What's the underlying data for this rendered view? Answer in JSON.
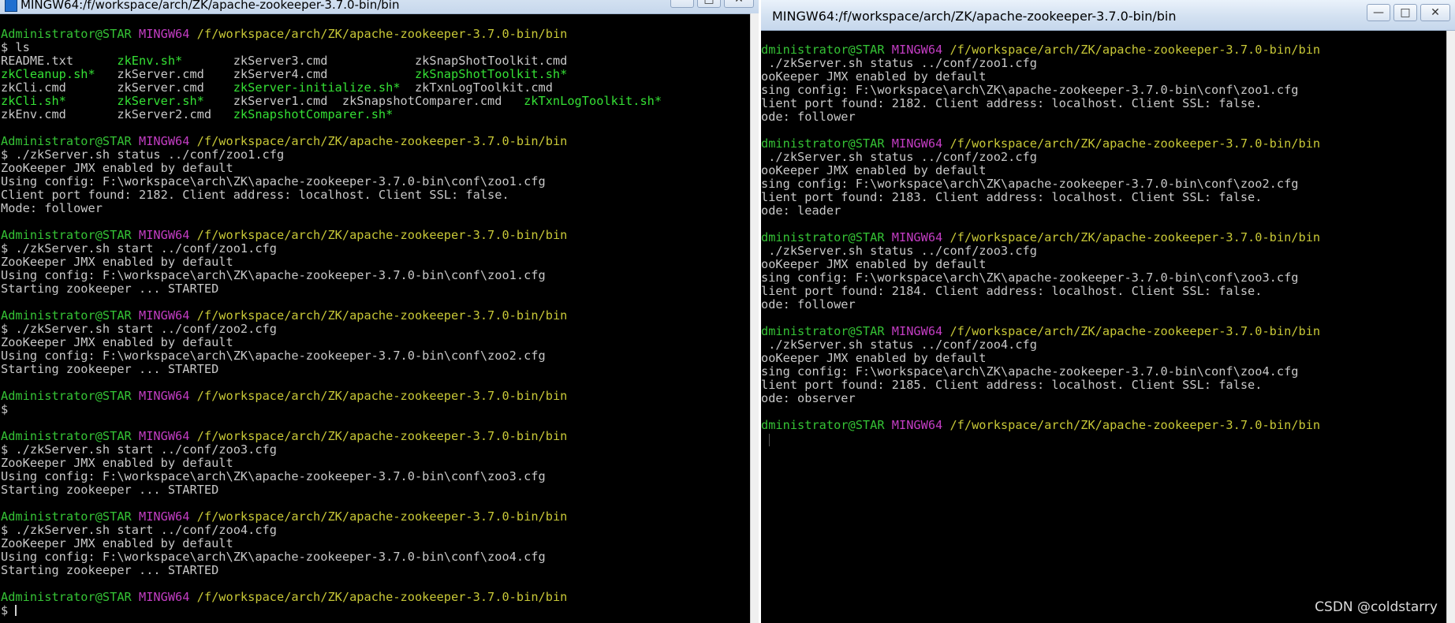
{
  "left_window": {
    "title": "MINGW64:/f/workspace/arch/ZK/apache-zookeeper-3.7.0-bin/bin",
    "controls": {
      "minimize": "—",
      "maximize": "□",
      "close": "✕"
    },
    "lines": [
      [
        {
          "t": "Administrator@STAR",
          "c": "user"
        },
        {
          "t": " MINGW64",
          "c": "mingw"
        },
        {
          "t": " /f/workspace/arch/ZK/apache-zookeeper-3.7.0-bin/bin",
          "c": "path"
        }
      ],
      [
        {
          "t": "$ ls",
          "c": "plain"
        }
      ],
      [
        {
          "t": "README.txt      ",
          "c": "plain"
        },
        {
          "t": "zkEnv.sh*",
          "c": "exe"
        },
        {
          "t": "       zkServer3.cmd            ",
          "c": "plain"
        },
        {
          "t": "zkSnapShotToolkit.cmd",
          "c": "plain"
        }
      ],
      [
        {
          "t": "zkCleanup.sh*",
          "c": "exe"
        },
        {
          "t": "   zkServer.cmd    zkServer4.cmd            ",
          "c": "plain"
        },
        {
          "t": "zkSnapShotToolkit.sh*",
          "c": "exe"
        }
      ],
      [
        {
          "t": "zkCli.cmd       zkServer.cmd    ",
          "c": "plain"
        },
        {
          "t": "zkServer-initialize.sh*",
          "c": "exe"
        },
        {
          "t": "  zkTxnLogToolkit.cmd",
          "c": "plain"
        }
      ],
      [
        {
          "t": "zkCli.sh*",
          "c": "exe"
        },
        {
          "t": "       ",
          "c": "plain"
        },
        {
          "t": "zkServer.sh*",
          "c": "exe"
        },
        {
          "t": "    zkServer1.cmd  zkSnapshotComparer.cmd   ",
          "c": "plain"
        },
        {
          "t": "zkTxnLogToolkit.sh*",
          "c": "exe"
        }
      ],
      [
        {
          "t": "zkEnv.cmd       zkServer2.cmd   ",
          "c": "plain"
        },
        {
          "t": "zkSnapshotComparer.sh*",
          "c": "exe"
        }
      ],
      [],
      [
        {
          "t": "Administrator@STAR",
          "c": "user"
        },
        {
          "t": " MINGW64",
          "c": "mingw"
        },
        {
          "t": " /f/workspace/arch/ZK/apache-zookeeper-3.7.0-bin/bin",
          "c": "path"
        }
      ],
      [
        {
          "t": "$ ./zkServer.sh status ../conf/zoo1.cfg",
          "c": "plain"
        }
      ],
      [
        {
          "t": "ZooKeeper JMX enabled by default",
          "c": "plain"
        }
      ],
      [
        {
          "t": "Using config: F:\\workspace\\arch\\ZK\\apache-zookeeper-3.7.0-bin\\conf\\zoo1.cfg",
          "c": "plain"
        }
      ],
      [
        {
          "t": "Client port found: 2182. Client address: localhost. Client SSL: false.",
          "c": "plain"
        }
      ],
      [
        {
          "t": "Mode: follower",
          "c": "plain"
        }
      ],
      [],
      [
        {
          "t": "Administrator@STAR",
          "c": "user"
        },
        {
          "t": " MINGW64",
          "c": "mingw"
        },
        {
          "t": " /f/workspace/arch/ZK/apache-zookeeper-3.7.0-bin/bin",
          "c": "path"
        }
      ],
      [
        {
          "t": "$ ./zkServer.sh start ../conf/zoo1.cfg",
          "c": "plain"
        }
      ],
      [
        {
          "t": "ZooKeeper JMX enabled by default",
          "c": "plain"
        }
      ],
      [
        {
          "t": "Using config: F:\\workspace\\arch\\ZK\\apache-zookeeper-3.7.0-bin\\conf\\zoo1.cfg",
          "c": "plain"
        }
      ],
      [
        {
          "t": "Starting zookeeper ... STARTED",
          "c": "plain"
        }
      ],
      [],
      [
        {
          "t": "Administrator@STAR",
          "c": "user"
        },
        {
          "t": " MINGW64",
          "c": "mingw"
        },
        {
          "t": " /f/workspace/arch/ZK/apache-zookeeper-3.7.0-bin/bin",
          "c": "path"
        }
      ],
      [
        {
          "t": "$ ./zkServer.sh start ../conf/zoo2.cfg",
          "c": "plain"
        }
      ],
      [
        {
          "t": "ZooKeeper JMX enabled by default",
          "c": "plain"
        }
      ],
      [
        {
          "t": "Using config: F:\\workspace\\arch\\ZK\\apache-zookeeper-3.7.0-bin\\conf\\zoo2.cfg",
          "c": "plain"
        }
      ],
      [
        {
          "t": "Starting zookeeper ... STARTED",
          "c": "plain"
        }
      ],
      [],
      [
        {
          "t": "Administrator@STAR",
          "c": "user"
        },
        {
          "t": " MINGW64",
          "c": "mingw"
        },
        {
          "t": " /f/workspace/arch/ZK/apache-zookeeper-3.7.0-bin/bin",
          "c": "path"
        }
      ],
      [
        {
          "t": "$",
          "c": "plain"
        }
      ],
      [],
      [
        {
          "t": "Administrator@STAR",
          "c": "user"
        },
        {
          "t": " MINGW64",
          "c": "mingw"
        },
        {
          "t": " /f/workspace/arch/ZK/apache-zookeeper-3.7.0-bin/bin",
          "c": "path"
        }
      ],
      [
        {
          "t": "$ ./zkServer.sh start ../conf/zoo3.cfg",
          "c": "plain"
        }
      ],
      [
        {
          "t": "ZooKeeper JMX enabled by default",
          "c": "plain"
        }
      ],
      [
        {
          "t": "Using config: F:\\workspace\\arch\\ZK\\apache-zookeeper-3.7.0-bin\\conf\\zoo3.cfg",
          "c": "plain"
        }
      ],
      [
        {
          "t": "Starting zookeeper ... STARTED",
          "c": "plain"
        }
      ],
      [],
      [
        {
          "t": "Administrator@STAR",
          "c": "user"
        },
        {
          "t": " MINGW64",
          "c": "mingw"
        },
        {
          "t": " /f/workspace/arch/ZK/apache-zookeeper-3.7.0-bin/bin",
          "c": "path"
        }
      ],
      [
        {
          "t": "$ ./zkServer.sh start ../conf/zoo4.cfg",
          "c": "plain"
        }
      ],
      [
        {
          "t": "ZooKeeper JMX enabled by default",
          "c": "plain"
        }
      ],
      [
        {
          "t": "Using config: F:\\workspace\\arch\\ZK\\apache-zookeeper-3.7.0-bin\\conf\\zoo4.cfg",
          "c": "plain"
        }
      ],
      [
        {
          "t": "Starting zookeeper ... STARTED",
          "c": "plain"
        }
      ],
      [],
      [
        {
          "t": "Administrator@STAR",
          "c": "user"
        },
        {
          "t": " MINGW64",
          "c": "mingw"
        },
        {
          "t": " /f/workspace/arch/ZK/apache-zookeeper-3.7.0-bin/bin",
          "c": "path"
        }
      ],
      [
        {
          "t": "$ ",
          "c": "plain"
        },
        {
          "cursor": true
        }
      ]
    ]
  },
  "right_window": {
    "title": "MINGW64:/f/workspace/arch/ZK/apache-zookeeper-3.7.0-bin/bin",
    "controls": {
      "minimize": "—",
      "maximize": "□",
      "close": "✕"
    },
    "lines": [
      [
        {
          "t": "dministrator@STAR",
          "c": "user"
        },
        {
          "t": " MINGW64",
          "c": "mingw"
        },
        {
          "t": " /f/workspace/arch/ZK/apache-zookeeper-3.7.0-bin/bin",
          "c": "path"
        }
      ],
      [
        {
          "t": " ./zkServer.sh status ../conf/zoo1.cfg",
          "c": "plain"
        }
      ],
      [
        {
          "t": "ooKeeper JMX enabled by default",
          "c": "plain"
        }
      ],
      [
        {
          "t": "sing config: F:\\workspace\\arch\\ZK\\apache-zookeeper-3.7.0-bin\\conf\\zoo1.cfg",
          "c": "plain"
        }
      ],
      [
        {
          "t": "lient port found: 2182. Client address: localhost. Client SSL: false.",
          "c": "plain"
        }
      ],
      [
        {
          "t": "ode: follower",
          "c": "plain"
        }
      ],
      [],
      [
        {
          "t": "dministrator@STAR",
          "c": "user"
        },
        {
          "t": " MINGW64",
          "c": "mingw"
        },
        {
          "t": " /f/workspace/arch/ZK/apache-zookeeper-3.7.0-bin/bin",
          "c": "path"
        }
      ],
      [
        {
          "t": " ./zkServer.sh status ../conf/zoo2.cfg",
          "c": "plain"
        }
      ],
      [
        {
          "t": "ooKeeper JMX enabled by default",
          "c": "plain"
        }
      ],
      [
        {
          "t": "sing config: F:\\workspace\\arch\\ZK\\apache-zookeeper-3.7.0-bin\\conf\\zoo2.cfg",
          "c": "plain"
        }
      ],
      [
        {
          "t": "lient port found: 2183. Client address: localhost. Client SSL: false.",
          "c": "plain"
        }
      ],
      [
        {
          "t": "ode: leader",
          "c": "plain"
        }
      ],
      [],
      [
        {
          "t": "dministrator@STAR",
          "c": "user"
        },
        {
          "t": " MINGW64",
          "c": "mingw"
        },
        {
          "t": " /f/workspace/arch/ZK/apache-zookeeper-3.7.0-bin/bin",
          "c": "path"
        }
      ],
      [
        {
          "t": " ./zkServer.sh status ../conf/zoo3.cfg",
          "c": "plain"
        }
      ],
      [
        {
          "t": "ooKeeper JMX enabled by default",
          "c": "plain"
        }
      ],
      [
        {
          "t": "sing config: F:\\workspace\\arch\\ZK\\apache-zookeeper-3.7.0-bin\\conf\\zoo3.cfg",
          "c": "plain"
        }
      ],
      [
        {
          "t": "lient port found: 2184. Client address: localhost. Client SSL: false.",
          "c": "plain"
        }
      ],
      [
        {
          "t": "ode: follower",
          "c": "plain"
        }
      ],
      [],
      [
        {
          "t": "dministrator@STAR",
          "c": "user"
        },
        {
          "t": " MINGW64",
          "c": "mingw"
        },
        {
          "t": " /f/workspace/arch/ZK/apache-zookeeper-3.7.0-bin/bin",
          "c": "path"
        }
      ],
      [
        {
          "t": " ./zkServer.sh status ../conf/zoo4.cfg",
          "c": "plain"
        }
      ],
      [
        {
          "t": "ooKeeper JMX enabled by default",
          "c": "plain"
        }
      ],
      [
        {
          "t": "sing config: F:\\workspace\\arch\\ZK\\apache-zookeeper-3.7.0-bin\\conf\\zoo4.cfg",
          "c": "plain"
        }
      ],
      [
        {
          "t": "lient port found: 2185. Client address: localhost. Client SSL: false.",
          "c": "plain"
        }
      ],
      [
        {
          "t": "ode: observer",
          "c": "plain"
        }
      ],
      [],
      [
        {
          "t": "dministrator@STAR",
          "c": "user"
        },
        {
          "t": " MINGW64",
          "c": "mingw"
        },
        {
          "t": " /f/workspace/arch/ZK/apache-zookeeper-3.7.0-bin/bin",
          "c": "path"
        }
      ]
    ]
  },
  "watermark": "CSDN @coldstarry",
  "colors": {
    "background": "#000000",
    "prompt_user": "#35c335",
    "prompt_mingw": "#c33dc3",
    "prompt_path": "#c8c837",
    "executable": "#35e035",
    "text": "#c8c8c8"
  }
}
